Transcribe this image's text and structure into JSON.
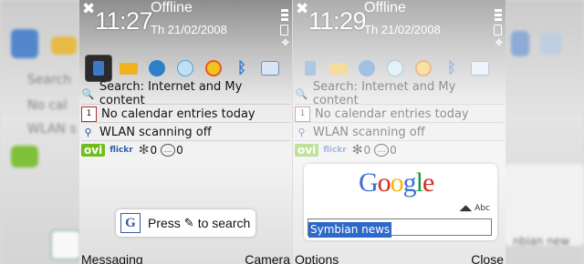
{
  "left_bg": {
    "text1": "Search",
    "text2": "No cal",
    "text3": "WLAN s"
  },
  "right_bg": {
    "field": "nbian new"
  },
  "screen1": {
    "close": "✖",
    "time": "11:27",
    "profile": "Offline",
    "date": "Th 21/02/2008",
    "search_row": "Search: Internet and My content",
    "calendar_row": "No calendar entries today",
    "calendar_day": "1",
    "wlan_row": "WLAN scanning off",
    "ovi": "ovi",
    "flickr": "flickr",
    "star_count": "0",
    "bubble_count": "0",
    "press_search": "Press",
    "to_search": "to search",
    "softkey_left": "Messaging",
    "softkey_right": "Camera"
  },
  "screen2": {
    "close": "✖",
    "time": "11:29",
    "profile": "Offline",
    "date": "Th 21/02/2008",
    "search_row": "Search: Internet and My content",
    "calendar_row": "No calendar entries today",
    "calendar_day": "1",
    "wlan_row": "WLAN scanning off",
    "ovi": "ovi",
    "flickr": "flickr",
    "star_count": "0",
    "bubble_count": "0",
    "google_logo": "Google",
    "abc": "Abc",
    "search_value": "Symbian news",
    "softkey_left": "Options",
    "softkey_right": "Close"
  },
  "colors": {
    "google_blue": "#3b6fd8",
    "google_red": "#d62d20",
    "google_yellow": "#f2b705",
    "google_green": "#1a9b3a"
  }
}
